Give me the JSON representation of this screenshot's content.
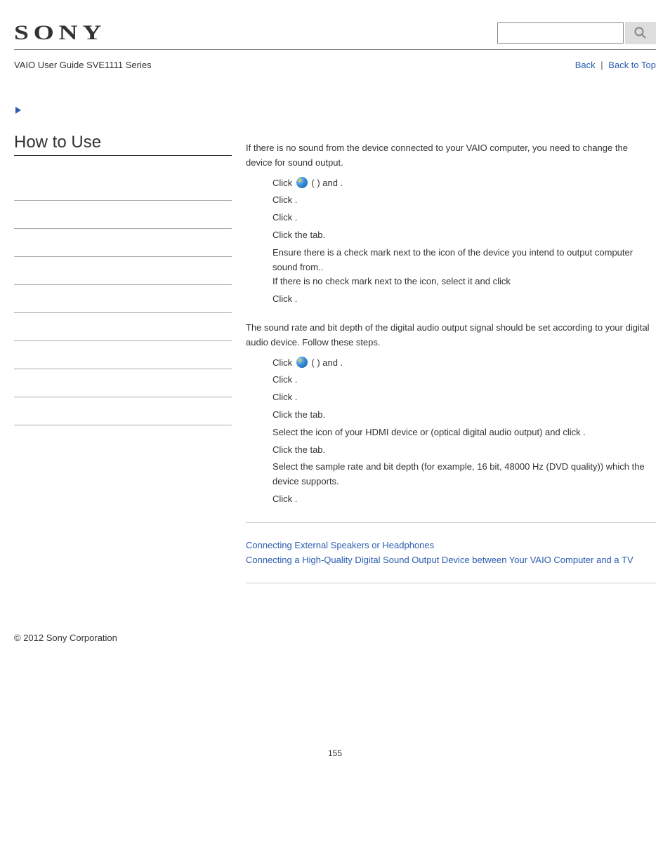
{
  "header": {
    "logo": "SONY",
    "breadcrumb": "VAIO User Guide SVE1111 Series",
    "back": "Back",
    "back_to_top": "Back to Top"
  },
  "sidebar": {
    "title": "How to Use",
    "nav_count": 9
  },
  "main": {
    "intro1": "If there is no sound from the device connected to your VAIO computer, you need to change the device for sound output.",
    "steps1": [
      {
        "pre": "Click ",
        "orb": true,
        "mid": " (            ) and ",
        "post": "."
      },
      {
        "pre": "Click ",
        "post": "."
      },
      {
        "pre": "Click ",
        "post": "."
      },
      {
        "pre": "Click the ",
        "post": " tab."
      },
      {
        "pre": "Ensure there is a check mark next to the icon of the device you intend to output computer sound from.",
        "br": true,
        "line2": "If there is no check mark next to the icon, select it and click ",
        "post": "."
      },
      {
        "pre": "Click ",
        "post": "."
      }
    ],
    "intro2": "The sound rate and bit depth of the digital audio output signal should be set according to your digital audio device. Follow these steps.",
    "steps2": [
      {
        "pre": "Click ",
        "orb": true,
        "mid": " (            ) and ",
        "post": "."
      },
      {
        "pre": "Click ",
        "post": "."
      },
      {
        "pre": "Click ",
        "post": "."
      },
      {
        "pre": "Click the ",
        "post": " tab."
      },
      {
        "pre": "Select the icon of your HDMI device or                                                  (optical digital audio output) and click ",
        "post": "."
      },
      {
        "pre": "Click the ",
        "post": " tab."
      },
      {
        "pre": "Select the sample rate and bit depth (for example, 16 bit, 48000 Hz (DVD quality)) which the device supports."
      },
      {
        "pre": "Click ",
        "post": "."
      }
    ],
    "related": [
      "Connecting External Speakers or Headphones",
      "Connecting a High-Quality Digital Sound Output Device between Your VAIO Computer and a TV"
    ]
  },
  "footer": {
    "copyright": "© 2012 Sony Corporation",
    "page": "155"
  }
}
